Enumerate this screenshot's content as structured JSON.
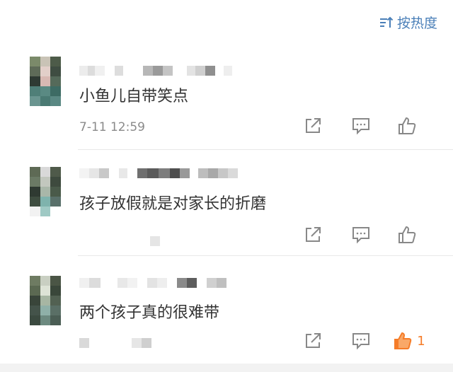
{
  "sort": {
    "label": "按热度",
    "icon": "sort-icon"
  },
  "comments": [
    {
      "text": "小鱼儿自带笑点",
      "time": "7-11 12:59",
      "like_count": "",
      "liked": false
    },
    {
      "text": "孩子放假就是对家长的折磨",
      "time": "",
      "like_count": "",
      "liked": false
    },
    {
      "text": "两个孩子真的很难带",
      "time": "",
      "like_count": "1",
      "liked": true
    }
  ],
  "icons": {
    "share": "share-icon",
    "reply": "reply-icon",
    "like": "like-icon"
  },
  "colors": {
    "accent": "#4a7fb8",
    "liked": "#f57c28",
    "text": "#333333",
    "muted": "#8a8a8a"
  }
}
